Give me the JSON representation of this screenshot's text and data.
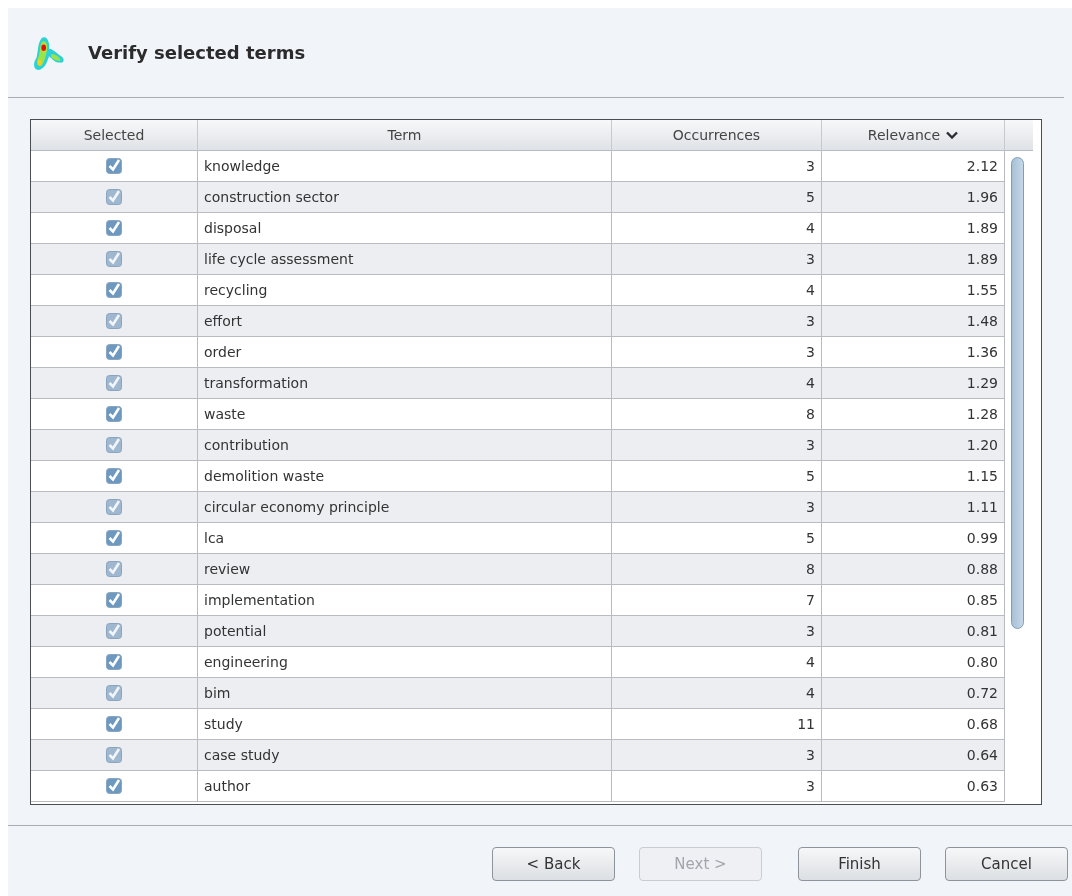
{
  "header": {
    "title": "Verify selected terms"
  },
  "table": {
    "columns": [
      {
        "label": "Selected",
        "sorted": false
      },
      {
        "label": "Term",
        "sorted": false
      },
      {
        "label": "Occurrences",
        "sorted": false
      },
      {
        "label": "Relevance",
        "sorted": true
      }
    ],
    "rows": [
      {
        "selected": true,
        "term": "knowledge",
        "occurrences": "3",
        "relevance": "2.12"
      },
      {
        "selected": true,
        "term": "construction sector",
        "occurrences": "5",
        "relevance": "1.96"
      },
      {
        "selected": true,
        "term": "disposal",
        "occurrences": "4",
        "relevance": "1.89"
      },
      {
        "selected": true,
        "term": "life cycle assessment",
        "occurrences": "3",
        "relevance": "1.89"
      },
      {
        "selected": true,
        "term": "recycling",
        "occurrences": "4",
        "relevance": "1.55"
      },
      {
        "selected": true,
        "term": "effort",
        "occurrences": "3",
        "relevance": "1.48"
      },
      {
        "selected": true,
        "term": "order",
        "occurrences": "3",
        "relevance": "1.36"
      },
      {
        "selected": true,
        "term": "transformation",
        "occurrences": "4",
        "relevance": "1.29"
      },
      {
        "selected": true,
        "term": "waste",
        "occurrences": "8",
        "relevance": "1.28"
      },
      {
        "selected": true,
        "term": "contribution",
        "occurrences": "3",
        "relevance": "1.20"
      },
      {
        "selected": true,
        "term": "demolition waste",
        "occurrences": "5",
        "relevance": "1.15"
      },
      {
        "selected": true,
        "term": "circular economy principle",
        "occurrences": "3",
        "relevance": "1.11"
      },
      {
        "selected": true,
        "term": "lca",
        "occurrences": "5",
        "relevance": "0.99"
      },
      {
        "selected": true,
        "term": "review",
        "occurrences": "8",
        "relevance": "0.88"
      },
      {
        "selected": true,
        "term": "implementation",
        "occurrences": "7",
        "relevance": "0.85"
      },
      {
        "selected": true,
        "term": "potential",
        "occurrences": "3",
        "relevance": "0.81"
      },
      {
        "selected": true,
        "term": "engineering",
        "occurrences": "4",
        "relevance": "0.80"
      },
      {
        "selected": true,
        "term": "bim",
        "occurrences": "4",
        "relevance": "0.72"
      },
      {
        "selected": true,
        "term": "study",
        "occurrences": "11",
        "relevance": "0.68"
      },
      {
        "selected": true,
        "term": "case study",
        "occurrences": "3",
        "relevance": "0.64"
      },
      {
        "selected": true,
        "term": "author",
        "occurrences": "3",
        "relevance": "0.63"
      }
    ]
  },
  "buttons": [
    {
      "label": "< Back",
      "disabled": false
    },
    {
      "label": "Next >",
      "disabled": true
    },
    {
      "label": "Finish",
      "disabled": false
    },
    {
      "label": "Cancel",
      "disabled": false
    }
  ]
}
